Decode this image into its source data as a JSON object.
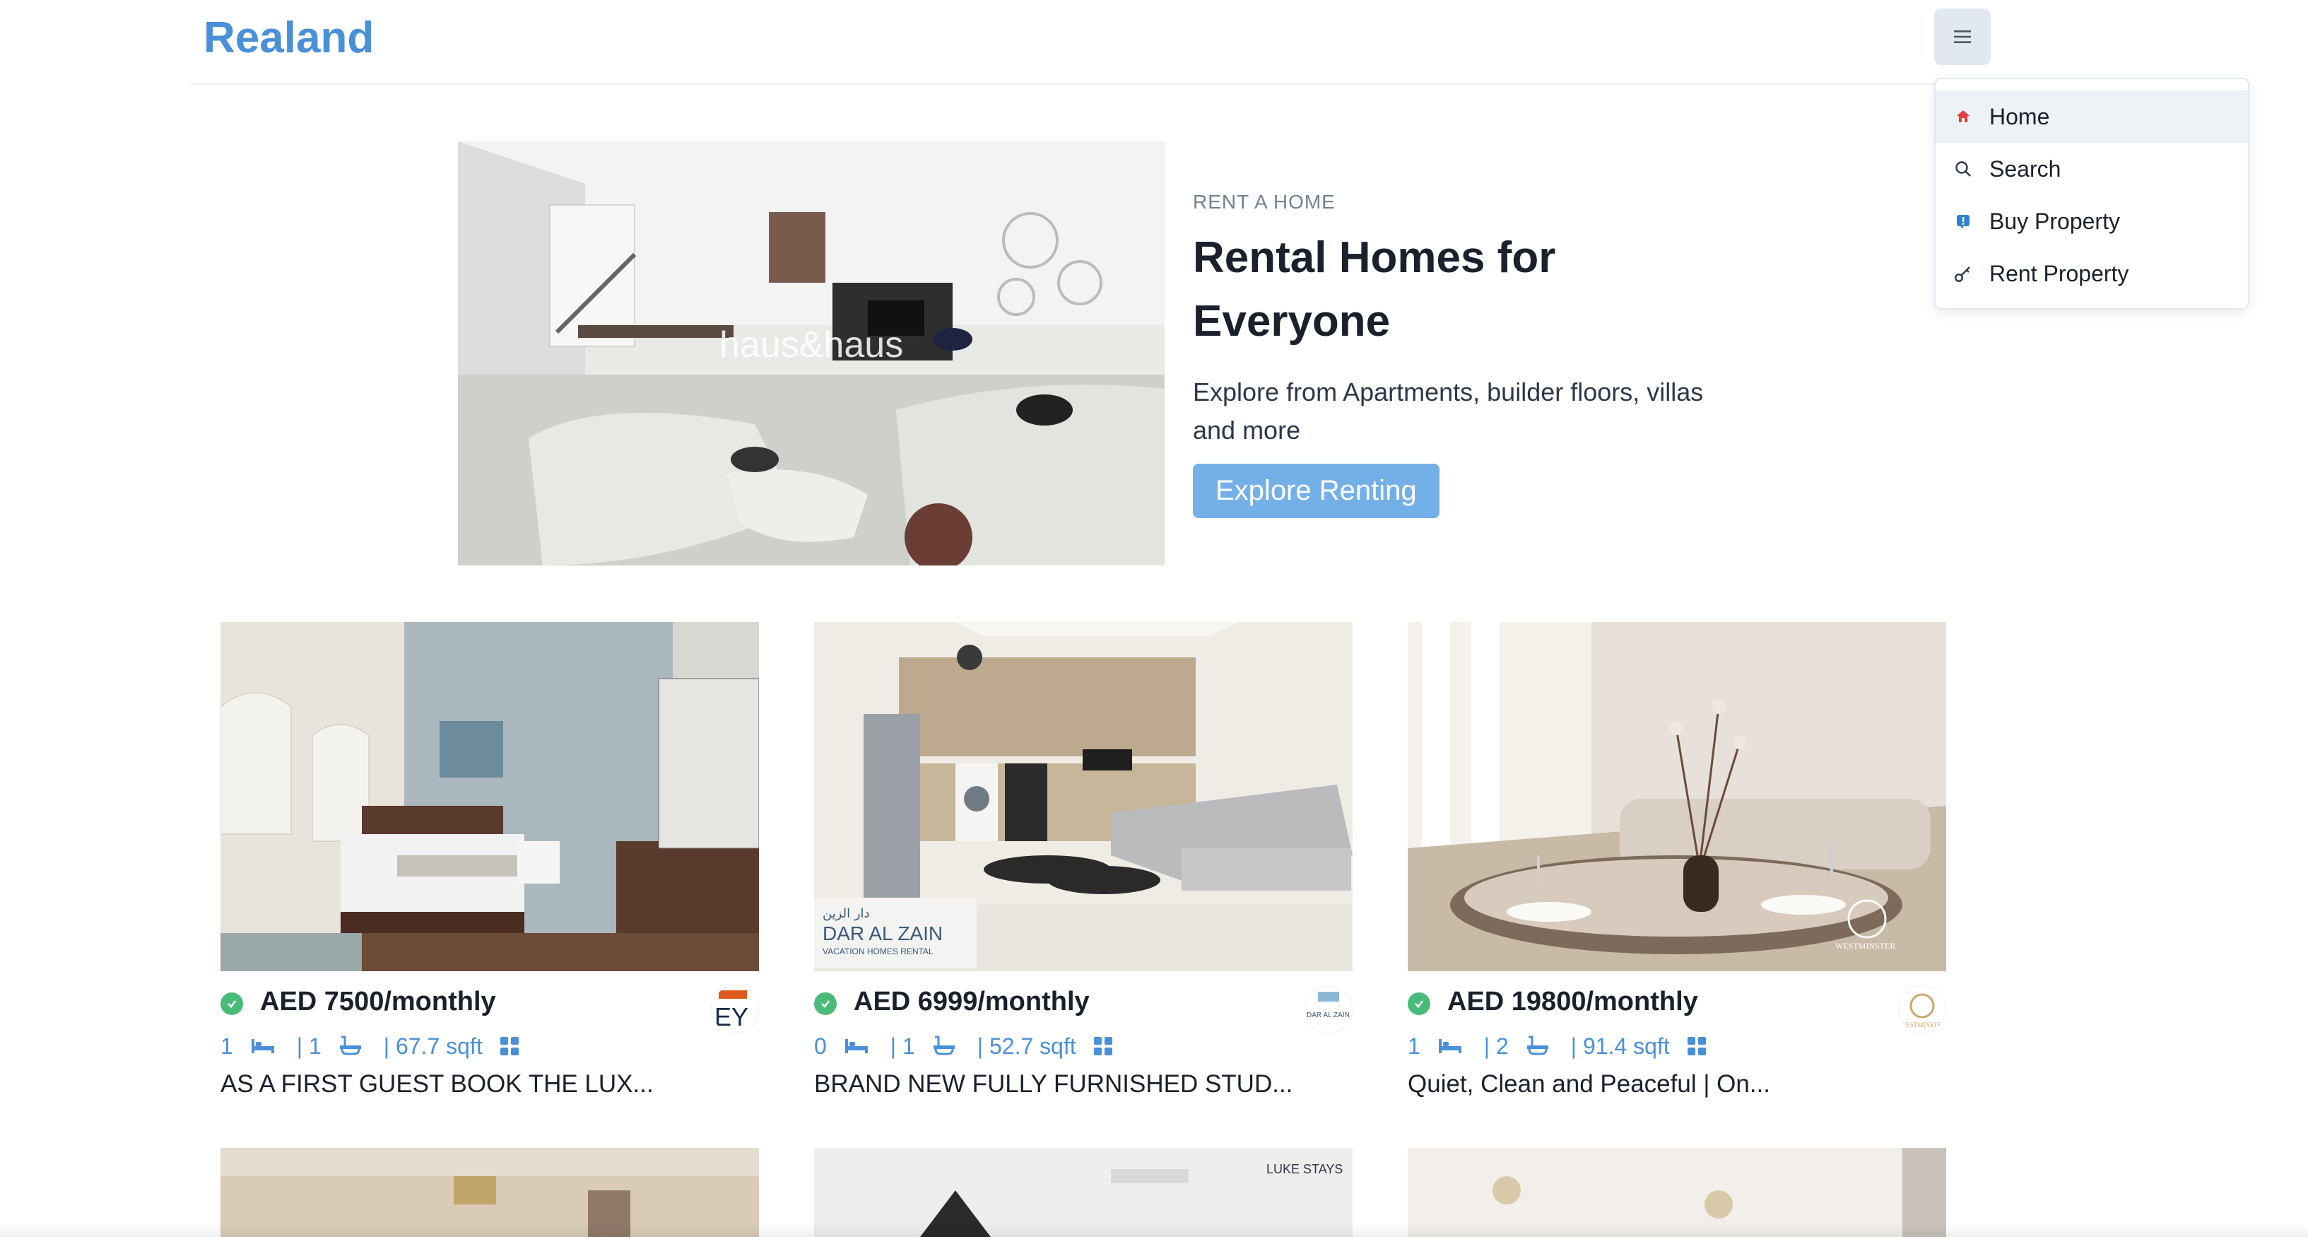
{
  "brand": "Realand",
  "menu": {
    "items": [
      {
        "label": "Home",
        "icon": "home-icon",
        "active": true
      },
      {
        "label": "Search",
        "icon": "search-icon",
        "active": false
      },
      {
        "label": "Buy Property",
        "icon": "info-tag-icon",
        "active": false
      },
      {
        "label": "Rent Property",
        "icon": "key-icon",
        "active": false
      }
    ]
  },
  "banner": {
    "eyebrow": "RENT A HOME",
    "title_line1": "Rental Homes for",
    "title_line2": "Everyone",
    "description": "Explore from Apartments, builder floors, villas and more",
    "cta": "Explore Renting",
    "watermark": "haus&haus"
  },
  "listings": [
    {
      "price": "AED 7500/monthly",
      "rooms": "1",
      "baths": "| 1",
      "area": "| 67.7 sqft",
      "title": "AS A FIRST GUEST BOOK THE LUX...",
      "agency": "EY"
    },
    {
      "price": "AED 6999/monthly",
      "rooms": "0",
      "baths": "| 1",
      "area": "| 52.7 sqft",
      "title": "BRAND NEW FULLY FURNISHED STUD...",
      "agency": "DAR AL ZAIN",
      "watermark_ar": "دار الزين",
      "watermark_en": "DAR AL ZAIN",
      "watermark_sub": "VACATION HOMES RENTAL"
    },
    {
      "price": "AED 19800/monthly",
      "rooms": "1",
      "baths": "| 2",
      "area": "| 91.4 sqft",
      "title": "Quiet, Clean and Peaceful | On...",
      "agency": "WESTMINSTER",
      "watermark": "WESTMINSTER"
    }
  ],
  "bottom_watermark": "LUKE STAYS",
  "colors": {
    "brand": "#4a90d9",
    "cta": "#74b0e8",
    "verified": "#48bb78"
  }
}
